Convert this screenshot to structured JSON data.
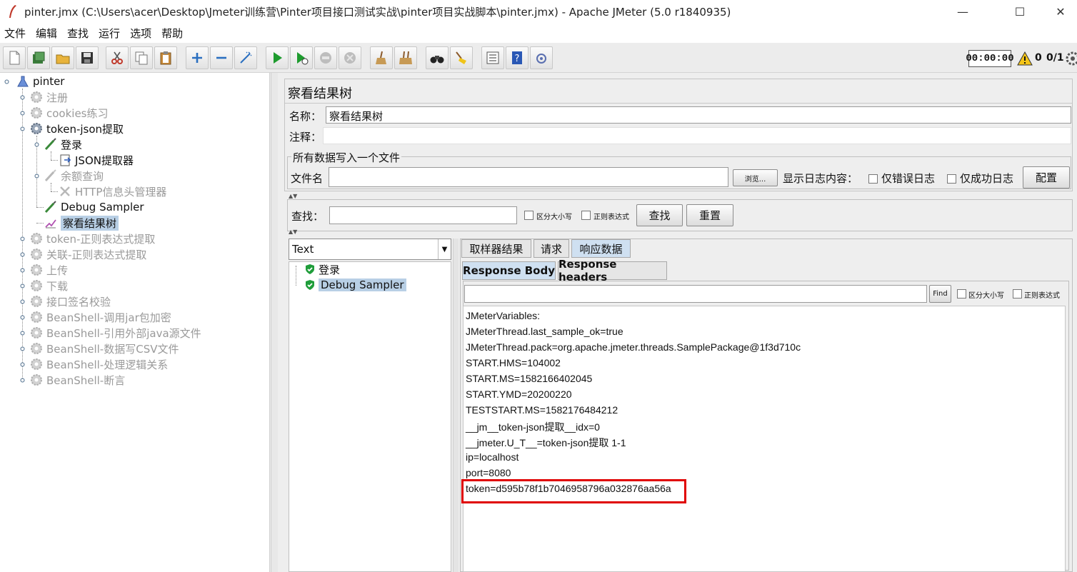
{
  "window": {
    "title": "pinter.jmx (C:\\Users\\acer\\Desktop\\Jmeter训练营\\Pinter项目接口测试实战\\pinter项目实战脚本\\pinter.jmx) - Apache JMeter (5.0 r1840935)",
    "minimize": "—",
    "maximize": "☐",
    "close": "✕"
  },
  "menu": [
    "文件",
    "编辑",
    "查找",
    "运行",
    "选项",
    "帮助"
  ],
  "status": {
    "timer": "00:00:00",
    "errors": "0",
    "threads": "0/1"
  },
  "tree": {
    "root": "pinter",
    "items": [
      {
        "label": "注册"
      },
      {
        "label": "cookies练习"
      },
      {
        "label": "token-json提取"
      },
      {
        "label": "登录"
      },
      {
        "label": "JSON提取器"
      },
      {
        "label": "余额查询"
      },
      {
        "label": "HTTP信息头管理器"
      },
      {
        "label": "Debug Sampler"
      },
      {
        "label": "察看结果树"
      },
      {
        "label": "token-正则表达式提取"
      },
      {
        "label": "关联-正则表达式提取"
      },
      {
        "label": "上传"
      },
      {
        "label": "下载"
      },
      {
        "label": "接口签名校验"
      },
      {
        "label": "BeanShell-调用jar包加密"
      },
      {
        "label": "BeanShell-引用外部java源文件"
      },
      {
        "label": "BeanShell-数据写CSV文件"
      },
      {
        "label": "BeanShell-处理逻辑关系"
      },
      {
        "label": "BeanShell-断言"
      }
    ]
  },
  "panel": {
    "title": "察看结果树",
    "name_label": "名称：",
    "name_value": "察看结果树",
    "comment_label": "注释：",
    "file_group": "所有数据写入一个文件",
    "file_label": "文件名",
    "browse": "浏览...",
    "log_label": "显示日志内容：",
    "errors_only": "仅错误日志",
    "success_only": "仅成功日志",
    "configure": "配置",
    "search_label": "查找：",
    "case_sensitive": "区分大小写",
    "regex": "正则表达式",
    "search_btn": "查找",
    "reset_btn": "重置"
  },
  "results": {
    "renderer": "Text",
    "samples": [
      "登录",
      "Debug Sampler"
    ],
    "tabs": [
      "取样器结果",
      "请求",
      "响应数据"
    ],
    "subtabs": [
      "Response Body",
      "Response headers"
    ],
    "find_btn": "Find",
    "case_sensitive": "区分大小写",
    "regex": "正则表达式",
    "lines": [
      "JMeterVariables:",
      "JMeterThread.last_sample_ok=true",
      "JMeterThread.pack=org.apache.jmeter.threads.SamplePackage@1f3d710c",
      "START.HMS=104002",
      "START.MS=1582166402045",
      "START.YMD=20200220",
      "TESTSTART.MS=1582176484212",
      "__jm__token-json提取__idx=0",
      "__jmeter.U_T__=token-json提取 1-1",
      "ip=localhost",
      "port=8080",
      "token=d595b78f1b7046958796a032876aa56a"
    ]
  },
  "colors": {
    "highlight_box": "#e00000",
    "selection": "#b8cfe5",
    "active_tab": "#cfe0f1"
  }
}
